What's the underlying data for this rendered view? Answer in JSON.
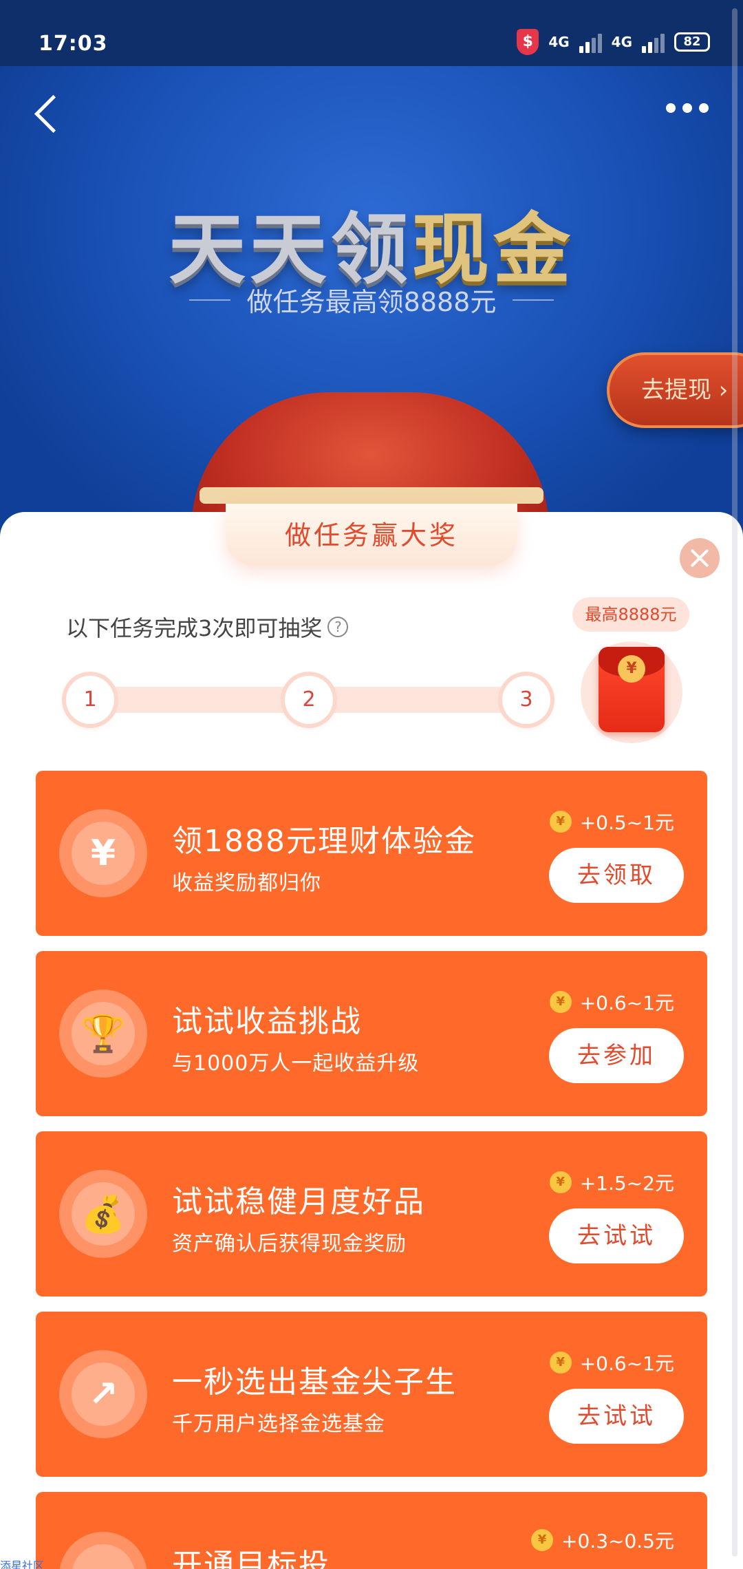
{
  "status_bar": {
    "time": "17:03",
    "network1": "4G",
    "network2": "4G",
    "battery": "82"
  },
  "hero": {
    "title_part1": "天天领",
    "title_part2": "现金",
    "subtitle": "做任务最高领8888元",
    "withdraw_label": "去提现"
  },
  "sheet": {
    "tab_title": "做任务赢大奖",
    "hint": "以下任务完成3次即可抽奖",
    "steps": [
      "1",
      "2",
      "3"
    ],
    "prize_tag": "最高8888元",
    "prize_coin": "¥"
  },
  "cards": [
    {
      "icon": "gift-cash-icon",
      "icon_glyph": "¥",
      "title": "领1888元理财体验金",
      "desc": "收益奖励都归你",
      "reward": "+0.5~1元",
      "button": "去领取"
    },
    {
      "icon": "trophy-icon",
      "icon_glyph": "🏆",
      "title": "试试收益挑战",
      "desc": "与1000万人一起收益升级",
      "reward": "+0.6~1元",
      "button": "去参加"
    },
    {
      "icon": "money-bag-icon",
      "icon_glyph": "💰",
      "title": "试试稳健月度好品",
      "desc": "资产确认后获得现金奖励",
      "reward": "+1.5~2元",
      "button": "去试试"
    },
    {
      "icon": "trend-arrow-icon",
      "icon_glyph": "↗",
      "title": "一秒选出基金尖子生",
      "desc": "千万用户选择金选基金",
      "reward": "+0.6~1元",
      "button": "去试试"
    },
    {
      "icon": "wallet-icon",
      "icon_glyph": "▬",
      "title": "开通目标投",
      "desc": "",
      "reward": "+0.3~0.5元",
      "button": ""
    }
  ],
  "coin_glyph": "¥",
  "watermark": "添星社区",
  "colors": {
    "card": "#ff6a2b",
    "accent": "#e14a2c",
    "hero": "#1b53b8"
  }
}
